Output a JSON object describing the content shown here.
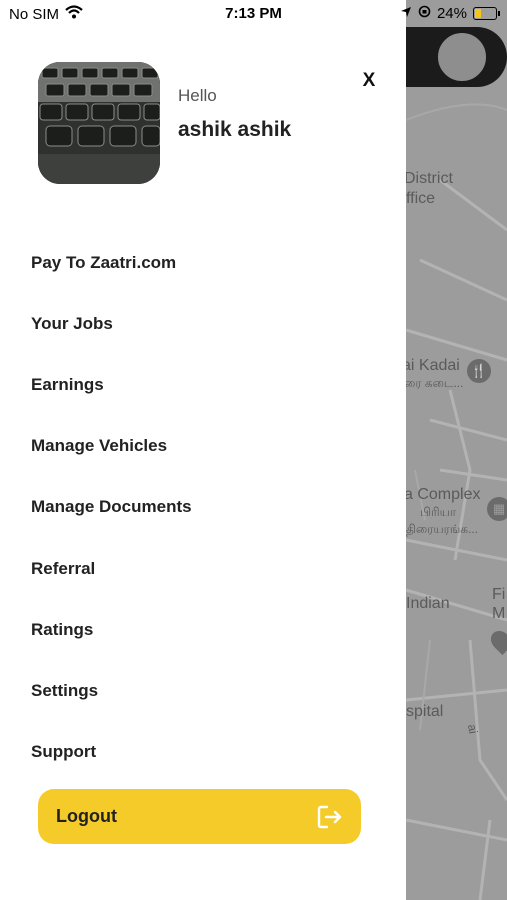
{
  "status_bar": {
    "carrier": "No SIM",
    "time": "7:13 PM",
    "battery": "24%"
  },
  "drawer": {
    "greeting": "Hello",
    "username": "ashik ashik",
    "close_label": "X",
    "menu_items": [
      "Pay To Zaatri.com",
      "Your Jobs",
      "Earnings",
      "Manage Vehicles",
      "Manage Documents",
      "Referral",
      "Ratings",
      "Settings",
      "Support"
    ],
    "logout_label": "Logout"
  },
  "map": {
    "labels": {
      "district": "District",
      "office": "ffice",
      "kadai": "ai Kadai",
      "kadai_tamil": "ரை கடை...",
      "complex": "a Complex",
      "complex_tamil1": "பிரியா",
      "complex_tamil2": "திரையரங்க...",
      "indian": "Indian",
      "fi": "Fi",
      "m": "M",
      "hospital": "spital",
      "ai": "ai"
    }
  },
  "colors": {
    "accent": "#f5cb29",
    "overlay": "#9c9c9c",
    "text": "#222222"
  }
}
